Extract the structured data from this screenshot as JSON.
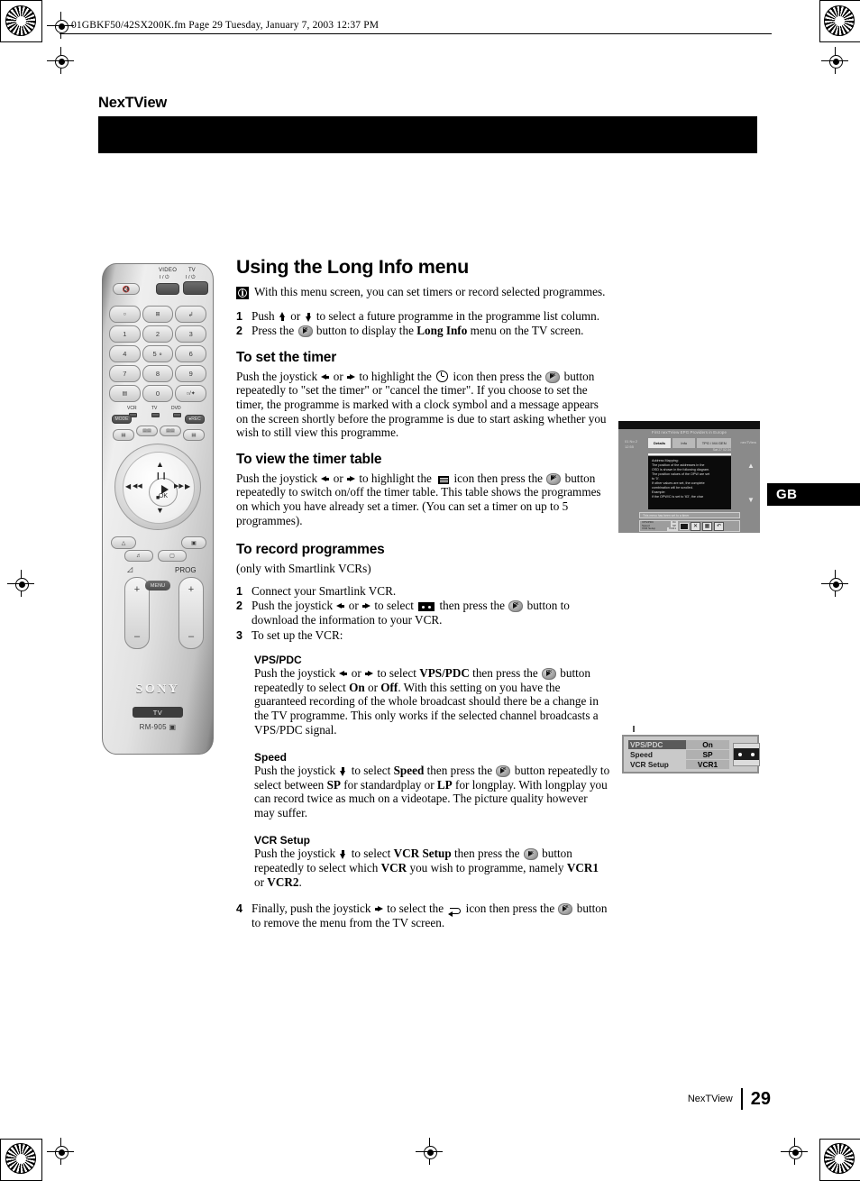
{
  "print_header": {
    "text": "01GBKF50/42SX200K.fm  Page 29  Tuesday, January 7, 2003  12:37 PM"
  },
  "chapter": {
    "title": "NexTView"
  },
  "language_tab": {
    "label": "GB"
  },
  "main": {
    "title": "Using the Long Info menu",
    "note": "With this menu screen, you can set timers or record selected programmes.",
    "intro_steps": [
      {
        "num": "1",
        "parts_before": "Push ",
        "parts_mid": " or ",
        "parts_after": " to select a future programme in the programme list column."
      },
      {
        "num": "2",
        "text_a": "Press the ",
        "text_b": " button to display the ",
        "bold": "Long Info",
        "text_c": " menu on the TV screen."
      }
    ],
    "sections": [
      {
        "heading": "To set the timer",
        "body_a": "Push the joystick ",
        "body_b": " or ",
        "body_c": " to highlight the ",
        "body_d": " icon then press the ",
        "body_e": " button repeatedly to \"set the timer\" or \"cancel the timer\". If you choose to set the timer, the programme is marked with a clock symbol and a message appears on the screen shortly before the programme is due to start asking whether you wish to still view this programme."
      },
      {
        "heading": "To view the timer table",
        "body_a": "Push the joystick ",
        "body_b": " or ",
        "body_c": " to highlight the ",
        "body_d": " icon then press the ",
        "body_e": " button repeatedly to switch on/off the timer table. This table shows the programmes on which you have already set a timer. (You can set a timer on up to 5 programmes)."
      },
      {
        "heading": "To record programmes",
        "subtitle": "(only with Smartlink VCRs)"
      }
    ],
    "record_steps": [
      {
        "num": "1",
        "text": "Connect your Smartlink VCR."
      },
      {
        "num": "2",
        "a": "Push the joystick ",
        "b": " or ",
        "c": " to select ",
        "d": " then press the ",
        "e": " button to download the information to your VCR."
      },
      {
        "num": "3",
        "text": "To set up the VCR:"
      }
    ],
    "vcr_settings": [
      {
        "heading": "VPS/PDC",
        "a": "Push the joystick ",
        "b": " or ",
        "c": " to select ",
        "bold1": "VPS/PDC",
        "d": " then press the ",
        "e": " button repeatedly to select ",
        "bold2": "On",
        "f": " or ",
        "bold3": "Off",
        "g": ". With this setting on you have the guaranteed recording of the whole broadcast should there be a change in the TV programme. This only works if the selected channel broadcasts a VPS/PDC signal."
      },
      {
        "heading": "Speed",
        "a": "Push the joystick ",
        "c": " to select ",
        "bold1": "Speed",
        "d": " then press the ",
        "e": " button repeatedly to select between ",
        "bold2": "SP",
        "f": " for standardplay or ",
        "bold3": "LP",
        "g": " for longplay. With longplay you can record twice as much on a videotape. The picture quality however may suffer."
      },
      {
        "heading": "VCR Setup",
        "a": "Push the joystick ",
        "c": " to select ",
        "bold1": "VCR Setup",
        "d": " then press the ",
        "e": " button repeatedly to select which ",
        "bold2": "VCR",
        "g": " you wish to programme, namely ",
        "bold3": "VCR1",
        "f": " or ",
        "bold4": "VCR2",
        "h": "."
      }
    ],
    "final_step": {
      "num": "4",
      "a": "Finally, push the joystick ",
      "b": " to select the ",
      "c": " icon then press the ",
      "d": " button to remove the menu from the TV screen."
    }
  },
  "figure_long_info": {
    "screen_title": "First nexTView EPG Providers in Europe",
    "left_label_line1": "01 No 2",
    "left_label_line2": "12:55",
    "right_label": "nexTView",
    "tabs": [
      {
        "label": "Details",
        "selected": true
      },
      {
        "label": "Info",
        "selected": false
      },
      {
        "label": "TPG / M4 GEN",
        "selected": false
      }
    ],
    "sub_label": "Sat 27  02:34",
    "body_lines": [
      "Address Mapping:",
      "",
      "The position of the addresses in the",
      "OSD is shown in the following diagram.",
      "The position values of the OPW are set",
      "to '0'.",
      "If other values are set, the complete",
      "combination will be scrolled.",
      "",
      "Example:",
      "if the OPW/C is set to '63', the char"
    ],
    "message_bar": "This menu has been set to a timer",
    "panel_rows": [
      {
        "label": "VPS/PDC",
        "value": "On"
      },
      {
        "label": "Speed",
        "value": "SP"
      },
      {
        "label": "VCR Setup",
        "value": "VCR1"
      }
    ],
    "panel_buttons": [
      "cancel-icon",
      "timer-table-icon",
      "return-icon"
    ]
  },
  "figure_vps_panel": {
    "rows": [
      {
        "label": "VPS/PDC",
        "value": "On",
        "selected": true
      },
      {
        "label": "Speed",
        "value": "SP",
        "selected": false
      },
      {
        "label": "VCR Setup",
        "value": "VCR1",
        "selected": false
      }
    ],
    "cassette_icon": "vcr-cassette-icon"
  },
  "remote": {
    "brand": "SONY",
    "mode_pill": "TV",
    "model": "RM-905",
    "top_labels": {
      "video": "VIDEO",
      "video_power": "I / ⏻",
      "tv": "TV",
      "tv_power": "I / ⏻"
    },
    "number_keys": [
      [
        "○",
        "⊡",
        "↰"
      ],
      [
        "1",
        "2",
        "3"
      ],
      [
        "4",
        "5",
        "6"
      ],
      [
        "7",
        "8",
        "9"
      ],
      [
        "▤",
        "0",
        "∴"
      ]
    ],
    "device_labels": [
      "VCR",
      "TV",
      "DVD"
    ],
    "mode_button": "MODE",
    "rec_button": "REC",
    "joystick": {
      "center_label": "OK"
    },
    "menu_button": "MENU",
    "volume_label": "◸",
    "prog_label": "PROG",
    "plus": "+",
    "minus": "–"
  },
  "footer": {
    "section": "NexTView",
    "page": "29"
  }
}
